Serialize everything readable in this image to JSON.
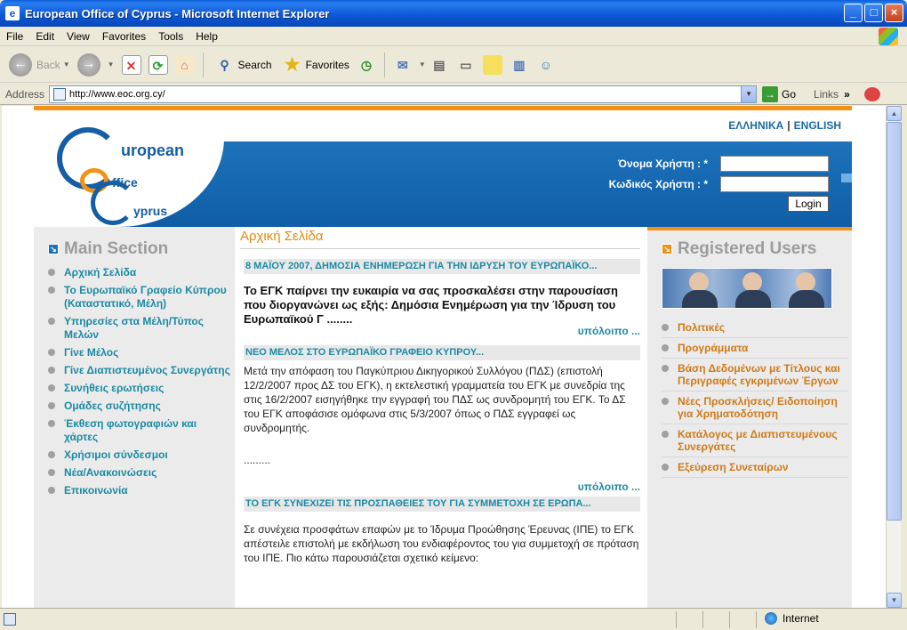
{
  "window": {
    "title": "European Office of Cyprus - Microsoft Internet Explorer",
    "app_icon": "ie-page-icon",
    "buttons": [
      "minimize-icon",
      "maximize-icon",
      "close-icon"
    ]
  },
  "menu": {
    "items": [
      "File",
      "Edit",
      "View",
      "Favorites",
      "Tools",
      "Help"
    ]
  },
  "toolbar": {
    "back_label": "Back",
    "search_label": "Search",
    "favorites_label": "Favorites"
  },
  "address": {
    "label": "Address",
    "url": "http://www.eoc.org.cy/",
    "go_label": "Go",
    "links_label": "Links"
  },
  "site": {
    "lang_greek": "ΕΛΛΗΝΙΚΑ",
    "lang_english": "ENGLISH",
    "logo": {
      "word1": "uropean",
      "word2": "ffice",
      "word3": "yprus"
    },
    "login": {
      "username_label": "Όνομα Χρήστη : *",
      "password_label": "Κωδικός Χρήστη : *",
      "button": "Login"
    },
    "main_section": {
      "title": "Main Section",
      "items": [
        "Αρχική Σελίδα",
        "Το Ευρωπαϊκό Γραφείο Κύπρου (Καταστατικό, Μέλη)",
        "Υπηρεσίες στα Μέλη/Τύπος Μελών",
        "Γίνε Μέλος",
        "Γίνε Διαπιστευμένος Συνεργάτης",
        "Συνήθεις ερωτήσεις",
        "Ομάδες συζήτησης",
        "Έκθεση φωτογραφιών και χάρτες",
        "Χρήσιμοι σύνδεσμοι",
        "Νέα/Ανακοινώσεις",
        "Επικοινωνία"
      ]
    },
    "center": {
      "page_title": "Αρχική Σελίδα",
      "news": [
        {
          "head": "8 ΜΑΪΟΥ 2007, ΔΗΜΟΣΙΑ ΕΝΗΜΕΡΩΣΗ ΓΙΑ ΤΗΝ ΙΔΡΥΣΗ ΤΟΥ ΕΥΡΩΠΑΪΚΟ...",
          "body": "Το ΕΓΚ παίρνει την ευκαιρία να σας προσκαλέσει στην παρουσίαση που διοργανώνει ως εξής: Δημόσια Ενημέρωση για την Ίδρυση του Ευρωπαϊκού Γ ........",
          "more": "υπόλοιπο ..."
        },
        {
          "head": "ΝΕΟ ΜΕΛΟΣ ΣΤΟ ΕΥΡΩΠΑΪΚΟ ΓΡΑΦΕΙΟ ΚΥΠΡΟΥ...",
          "body": "Μετά την απόφαση του Παγκύπριου Δικηγορικού Συλλόγου (ΠΔΣ) (επιστολή 12/2/2007 προς ΔΣ του ΕΓΚ), η εκτελεστική γραμματεία του ΕΓΚ με συνεδρία της στις 16/2/2007 εισηγήθηκε την εγγραφή του ΠΔΣ ως συνδρομητή του ΕΓΚ. Το ΔΣ του ΕΓΚ αποφάσισε ομόφωνα στις 5/3/2007 όπως ο ΠΔΣ εγγραφεί ως συνδρομητής.",
          "ellipsis": ".........",
          "more": "υπόλοιπο ..."
        },
        {
          "head": "ΤΟ ΕΓΚ ΣΥΝΕΧΙΖΕΙ ΤΙΣ ΠΡΟΣΠΑΘΕΙΕΣ ΤΟΥ ΓΙΑ ΣΥΜΜΕΤΟΧΗ ΣΕ ΕΡΩΠΑ...",
          "body": "Σε συνέχεια προσφάτων επαφών με το Ίδρυμα Προώθησης Έρευνας (ΙΠΕ) το ΕΓΚ απέστειλε επιστολή με εκδήλωση του ενδιαφέροντος του για συμμετοχή σε πρόταση του ΙΠΕ.  Πιο κάτω παρουσιάζεται σχετικό κείμενο:"
        }
      ]
    },
    "registered": {
      "title": "Registered Users",
      "items": [
        "Πολιτικές",
        "Προγράμματα",
        "Βάση Δεδομένων με Τίτλους και Περιγραφές εγκριμένων Έργων",
        "Νέες Προσκλήσεις/ Ειδοποίηση για Χρηματοδότηση",
        "Κατάλογος με Διαπιστευμένους Συνεργάτες",
        "Εξεύρεση Συνεταίρων"
      ]
    }
  },
  "status": {
    "zone": "Internet"
  },
  "colors": {
    "accent_orange": "#f29118",
    "site_blue": "#1d72ba",
    "link_teal": "#1b8aa3",
    "link_orange": "#d07a18"
  }
}
